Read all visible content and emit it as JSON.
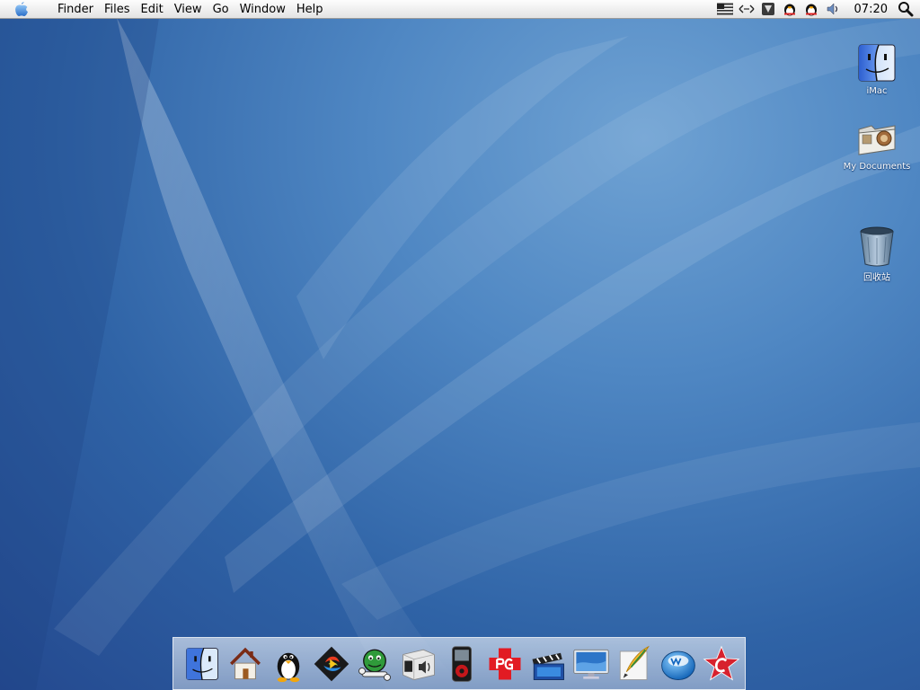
{
  "menubar": {
    "apple_icon": "apple-logo-icon",
    "items": [
      "Finder",
      "Files",
      "Edit",
      "View",
      "Go",
      "Window",
      "Help"
    ],
    "tray": [
      "us-flag-icon",
      "network-arrows-icon",
      "shield-icon",
      "qq-penguin-icon",
      "qq-penguin-icon",
      "volume-speaker-icon"
    ],
    "clock": "07:20",
    "search_icon": "magnifier-icon"
  },
  "desktop_icons": [
    {
      "label": "iMac",
      "icon": "finder-face-icon"
    },
    {
      "label": "My Documents",
      "icon": "documents-folder-icon"
    },
    {
      "label": "回收站",
      "icon": "trash-can-icon"
    }
  ],
  "dock": {
    "items": [
      "finder",
      "home",
      "tux-penguin",
      "media-player",
      "game-character",
      "speaker-box",
      "mp3-player",
      "pg-cross",
      "movie-clapper",
      "monitor",
      "feather-quill",
      "w-button",
      "red-star-c"
    ]
  },
  "colors": {
    "desktop_blue": "#3d6fb0",
    "menubar": "#eeeeee",
    "dock": "#b7c7de"
  }
}
